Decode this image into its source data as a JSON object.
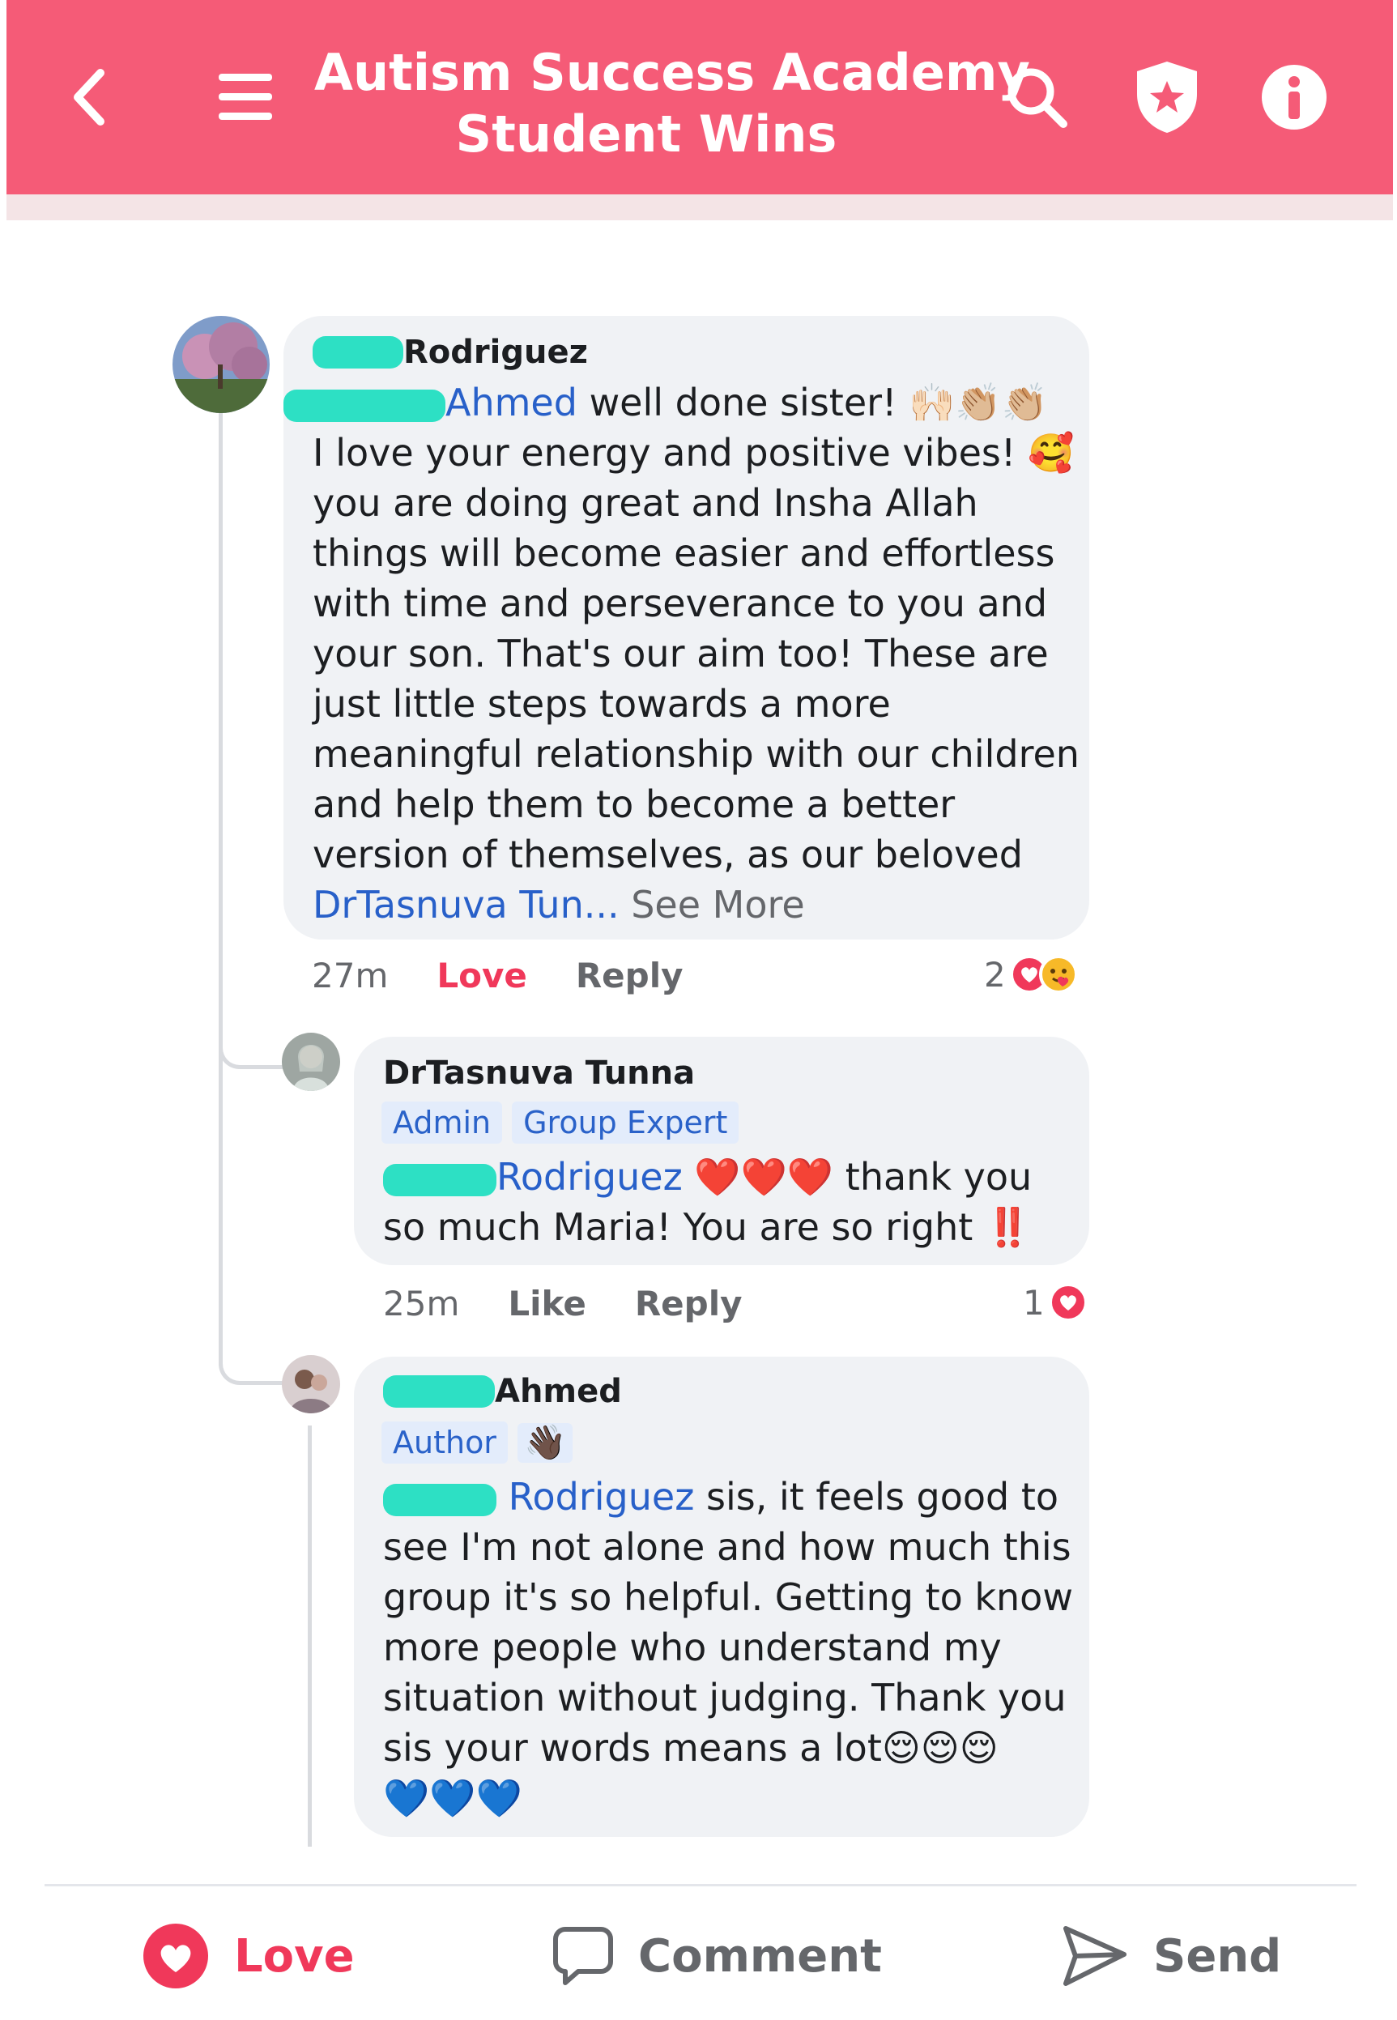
{
  "header": {
    "title_line1": "Autism Success Academy",
    "title_line2": "Student Wins",
    "icons": [
      "back-arrow-icon",
      "menu-icon",
      "search-icon",
      "shield-star-icon",
      "info-icon"
    ]
  },
  "colors": {
    "header_bg": "#f55b77",
    "mention": "#2860c9",
    "love": "#f0385a",
    "bubble": "#f0f2f5"
  },
  "comments": [
    {
      "author_name": "Rodriguez",
      "mention": "Ahmed",
      "lines": [
        "well done sister! 🙌🏻👏🏼👏🏼",
        "I love your energy and positive vibes! 🥰",
        "you are doing great and Insha Allah",
        "things will become easier and effortless",
        "with time and perseverance to you and",
        "your son. That's our aim too! These are",
        "just little steps towards a more",
        "meaningful relationship with our children",
        "and help them to become a better",
        "version of themselves, as our beloved"
      ],
      "last_mention": "DrTasnuva Tun...",
      "see_more": "See More",
      "time": "27m",
      "love_label": "Love",
      "reply_label": "Reply",
      "reaction_count": "2"
    },
    {
      "author_name": "DrTasnuva Tunna",
      "badges": [
        "Admin",
        "Group Expert"
      ],
      "mention": "Rodriguez",
      "lines": [
        "❤️❤️❤️ thank you",
        "so much Maria! You are so right ‼️"
      ],
      "time": "25m",
      "like_label": "Like",
      "reply_label": "Reply",
      "reaction_count": "1"
    },
    {
      "author_name": "Ahmed",
      "badges": [
        "Author"
      ],
      "badge_icon": "👋🏿",
      "mention": "Rodriguez",
      "lines": [
        "sis, it feels good to",
        "see I'm not alone and how much this",
        "group it's so helpful. Getting to know",
        "more people who understand my",
        "situation without judging. Thank you",
        "sis your words means a lot😌😌😌",
        "💙💙💙"
      ]
    }
  ],
  "actions": {
    "love_label": "Love",
    "comment_label": "Comment",
    "send_label": "Send"
  }
}
